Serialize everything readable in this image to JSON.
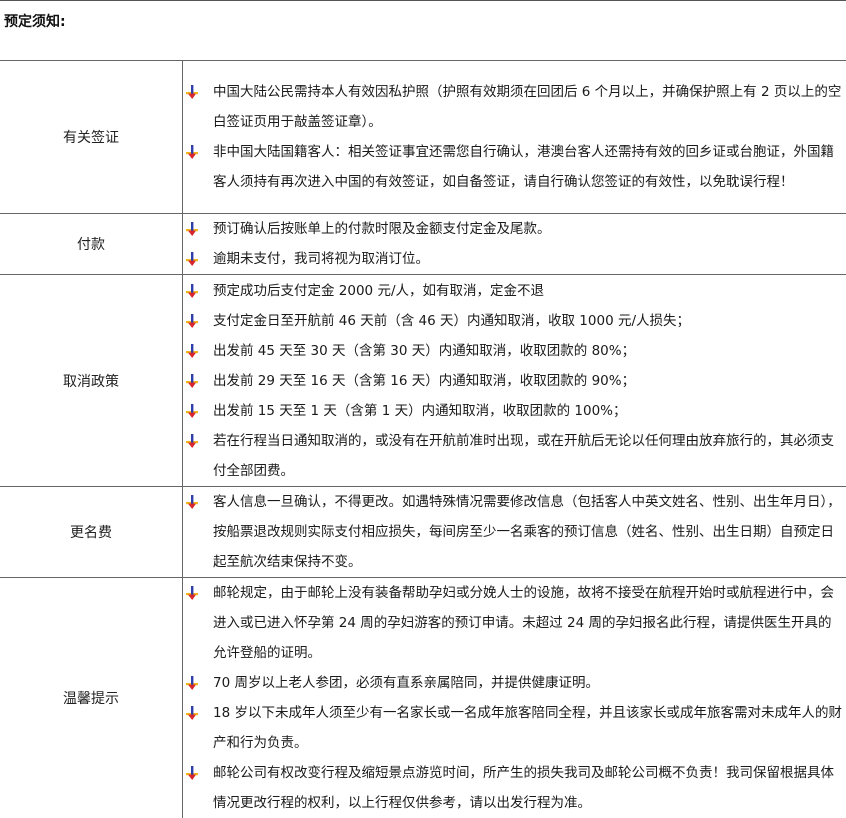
{
  "page_title": "预定须知:",
  "sections": [
    {
      "label": "有关签证",
      "items": [
        "中国大陆公民需持本人有效因私护照（护照有效期须在回团后 6 个月以上，并确保护照上有 2 页以上的空白签证页用于敲盖签证章）。",
        "非中国大陆国籍客人：相关签证事宜还需您自行确认，港澳台客人还需持有效的回乡证或台胞证，外国籍客人须持有再次进入中国的有效签证，如自备签证，请自行确认您签证的有效性，以免耽误行程！"
      ]
    },
    {
      "label": "付款",
      "items": [
        "预订确认后按账单上的付款时限及金额支付定金及尾款。",
        "逾期未支付，我司将视为取消订位。"
      ]
    },
    {
      "label": "取消政策",
      "items": [
        "预定成功后支付定金 2000 元/人，如有取消，定金不退",
        "支付定金日至开航前 46 天前（含 46 天）内通知取消，收取 1000 元/人损失；",
        "出发前 45 天至 30 天（含第 30 天）内通知取消，收取团款的 80%；",
        "出发前 29 天至 16 天（含第 16 天）内通知取消，收取团款的 90%；",
        "出发前 15 天至 1 天（含第 1 天）内通知取消，收取团款的 100%；",
        "若在行程当日通知取消的，或没有在开航前准时出现，或在开航后无论以任何理由放弃旅行的，其必须支付全部团费。"
      ]
    },
    {
      "label": "更名费",
      "items": [
        "客人信息一旦确认，不得更改。如遇特殊情况需要修改信息（包括客人中英文姓名、性别、出生年月日），按船票退改规则实际支付相应损失，每间房至少一名乘客的预订信息（姓名、性别、出生日期）自预定日起至航次结束保持不变。"
      ]
    },
    {
      "label": "温馨提示",
      "items": [
        "邮轮规定，由于邮轮上没有装备帮助孕妇或分娩人士的设施，故将不接受在航程开始时或航程进行中，会进入或已进入怀孕第 24 周的孕妇游客的预订申请。未超过 24 周的孕妇报名此行程，请提供医生开具的允许登船的证明。",
        "70 周岁以上老人参团，必须有直系亲属陪同，并提供健康证明。",
        "18 岁以下未成年人须至少有一名家长或一名成年旅客陪同全程，并且该家长或成年旅客需对未成年人的财产和行为负责。",
        "邮轮公司有权改变行程及缩短景点游览时间，所产生的损失我司及邮轮公司概不负责！我司保留根据具体情况更改行程的权利，以上行程仅供参考，请以出发行程为准。"
      ]
    }
  ],
  "colors": {
    "bullet_blue": "#2f3ea8",
    "bullet_red": "#d8262c",
    "bullet_yellow": "#f2b51c",
    "border": "#666666"
  },
  "icons": {
    "bullet": "pin-bullet-icon"
  }
}
